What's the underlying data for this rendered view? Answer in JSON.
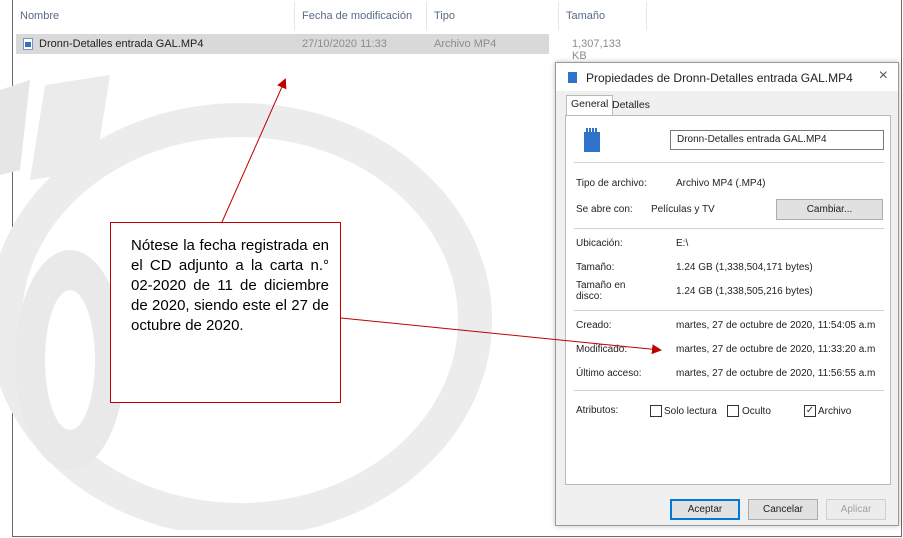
{
  "explorer": {
    "columns": [
      "Nombre",
      "Fecha de modificación",
      "Tipo",
      "Tamaño"
    ],
    "file": {
      "name": "Dronn-Detalles entrada GAL.MP4",
      "modified": "27/10/2020 11:33",
      "type": "Archivo MP4",
      "size": "1,307,133 KB"
    }
  },
  "dialog": {
    "title": "Propiedades de Dronn-Detalles entrada GAL.MP4",
    "close": "×",
    "tabs": [
      "General",
      "Detalles"
    ],
    "filename": "Dronn-Detalles entrada GAL.MP4",
    "fields": {
      "type_label": "Tipo de archivo:",
      "type_value": "Archivo MP4 (.MP4)",
      "opens_label": "Se abre con:",
      "opens_value": "Películas y TV",
      "change_button": "Cambiar...",
      "location_label": "Ubicación:",
      "location_value": "E:\\",
      "size_label": "Tamaño:",
      "size_value": "1.24 GB (1,338,504,171 bytes)",
      "disk_label": "Tamaño en disco:",
      "disk_value": "1.24 GB (1,338,505,216 bytes)",
      "created_label": "Creado:",
      "created_value": "martes, 27 de octubre de 2020, 11:54:05 a.m",
      "modified_label": "Modificado:",
      "modified_value": "martes, 27 de octubre de 2020, 11:33:20 a.m",
      "accessed_label": "Último acceso:",
      "accessed_value": "martes, 27 de octubre de 2020, 11:56:55 a.m",
      "attributes_label": "Atributos:",
      "readonly": "Solo lectura",
      "hidden": "Oculto",
      "archive": "Archivo",
      "archive_checked": true
    },
    "buttons": {
      "ok": "Aceptar",
      "cancel": "Cancelar",
      "apply": "Aplicar"
    }
  },
  "annotation": {
    "text": "Nótese la fecha registrada en el CD adjunto a la carta n.° 02-2020 de 11 de diciembre de 2020, siendo este el 27 de octubre de 2020.",
    "color": "#c00000"
  },
  "colors": {
    "accent": "#0078d7",
    "annotation": "#c00000",
    "selection": "#d9d9d9"
  }
}
